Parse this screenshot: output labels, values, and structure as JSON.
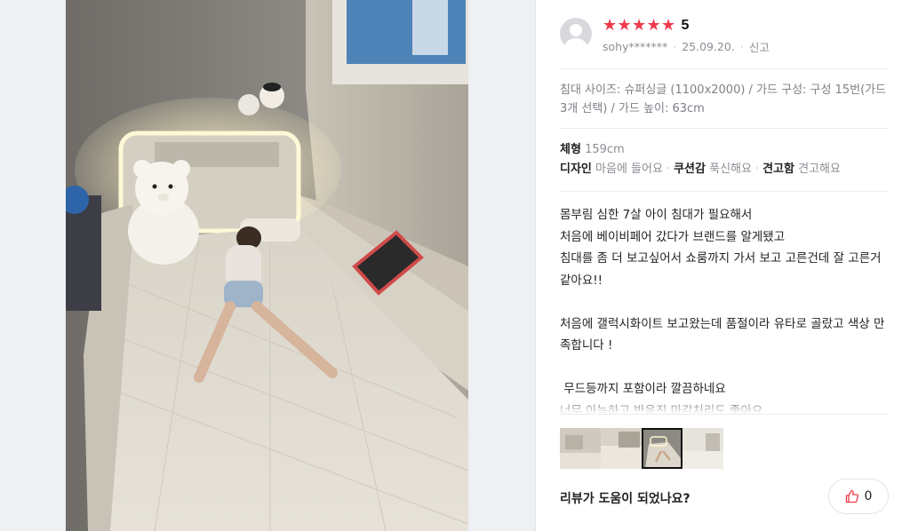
{
  "photo": {
    "alt_icon": "review-photo"
  },
  "review": {
    "rating": {
      "stars": 5,
      "score": "5"
    },
    "author": "sohy*******",
    "date": "25.09.20.",
    "report_label": "신고",
    "options": "침대 사이즈: 슈퍼싱글 (1100x2000) / 가드 구성: 구성 15번(가드 3개 선택) / 가드 높이: 63cm",
    "attributes": {
      "body_key": "체형",
      "body_val": "159cm",
      "design_key": "디자인",
      "design_val": "마음에 들어요",
      "cushion_key": "쿠션감",
      "cushion_val": "푹신해요",
      "firm_key": "견고함",
      "firm_val": "견고해요"
    },
    "text": "몸부림 심한 7살 아이 침대가 필요해서\n처음에 베이비페어 갔다가 브랜드를 알게됐고\n침대를 좀 더 보고싶어서 쇼룸까지 가서 보고 고른건데 잘 고른거 같아요!!\n\n처음에 갤럭시화이트 보고왔는데 품절이라 유타로 골랐고 색상 만족합니다 !\n\n 무드등까지 포함이라 깔끔하네요\n너무 아늑하고 반응진 마감처리도 좋아요",
    "thumbnails": [
      "thumb-1",
      "thumb-2",
      "thumb-3",
      "thumb-4"
    ],
    "active_thumbnail": 2,
    "helpful_question": "리뷰가 도움이 되었나요?",
    "like_count": "0"
  },
  "colors": {
    "star": "#ee3a4a",
    "accent": "#ee3a4a"
  }
}
